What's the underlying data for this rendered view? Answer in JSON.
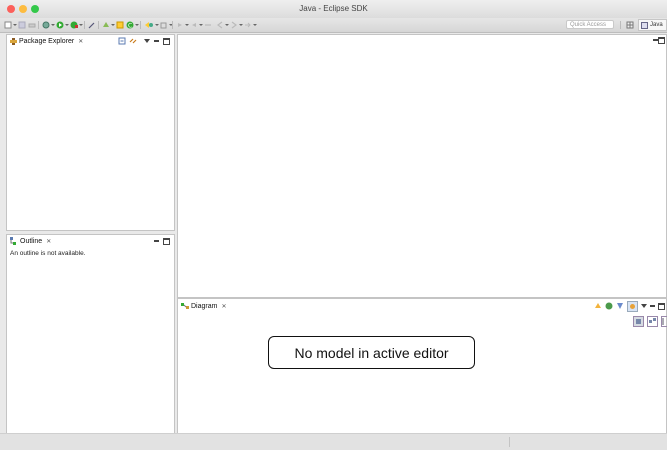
{
  "window": {
    "title": "Java - Eclipse SDK"
  },
  "toolbar": {
    "quick_access_placeholder": "Quick Access",
    "perspective_label": "Java"
  },
  "package_explorer": {
    "title": "Package Explorer",
    "close": "✕"
  },
  "outline": {
    "title": "Outline",
    "close": "✕",
    "message": "An outline is not available."
  },
  "diagram": {
    "title": "Diagram",
    "close": "✕",
    "message": "No model in active editor"
  },
  "colors": {
    "close_button": "#fc605b",
    "minimize_button": "#fdbc40",
    "zoom_button": "#34c84a"
  },
  "icons": [
    "new-icon",
    "save-icon",
    "print-icon",
    "debug-icon",
    "run-icon",
    "external-tools-icon",
    "new-java-project-icon",
    "new-package-icon",
    "new-class-icon",
    "open-type-icon",
    "search-icon",
    "annotation-icon",
    "back-icon",
    "forward-icon",
    "perspective-icon"
  ]
}
